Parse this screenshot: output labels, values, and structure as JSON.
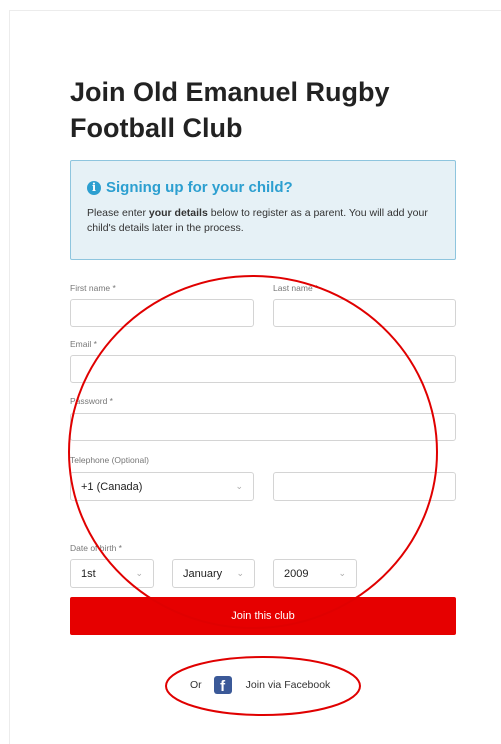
{
  "page": {
    "title": "Join Old Emanuel Rugby Football Club"
  },
  "info": {
    "heading": "Signing up for your child?",
    "text_before": "Please enter ",
    "text_bold": "your details",
    "text_after": " below to register as a parent. You will add your child's details later in the process."
  },
  "form": {
    "first_name_label": "First name *",
    "last_name_label": "Last name *",
    "email_label": "Email *",
    "password_label": "Password *",
    "telephone_label": "Telephone (Optional)",
    "country_code_value": "+1 (Canada)",
    "dob_label": "Date of birth *",
    "dob_day": "1st",
    "dob_month": "January",
    "dob_year": "2009",
    "submit_label": "Join this club"
  },
  "facebook": {
    "or_label": "Or",
    "icon_glyph": "f",
    "link_label": "Join via Facebook"
  },
  "colors": {
    "accent_blue": "#2c9fd0",
    "button_red": "#e60000",
    "annotation_red": "#e00000",
    "facebook_blue": "#3b5998"
  }
}
